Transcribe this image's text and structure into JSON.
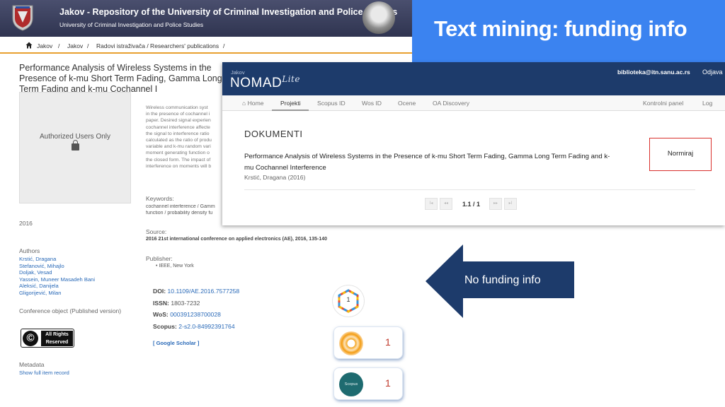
{
  "repository": {
    "title": "Jakov - Repository of the University of Criminal Investigation and Police Studies",
    "subtitle": "University of Criminal Investigation and Police Studies",
    "breadcrumbs": [
      "Jakov",
      "/",
      "Jakov",
      "/",
      "Radovi istraživača / Researchers' publications",
      "/"
    ],
    "doc_title": "Performance Analysis of Wireless Systems in the Presence of k-mu Short Term Fading, Gamma Long Term Fading and k-mu Cochannel I",
    "auth_box": "Authorized Users Only",
    "abstract_lines": [
      "Wireless communication syst",
      "in the presence of cochannel i",
      "paper. Desired signal experien",
      "cochannel interference affecte",
      "the signal to interference ratio",
      "calculated as the ratio of produ",
      "variable and k-mu random vari",
      "moment generating function o",
      "the closed form. The impact of",
      "interference on moments will b"
    ],
    "keywords_label": "Keywords:",
    "keywords_lines": [
      "cochannel interference / Gamm",
      "function / probability density fu"
    ],
    "year": "2016",
    "source_label": "Source:",
    "source_value": "2016 21st international conference on applied electronics (AE), 2016, 135-140",
    "publisher_label": "Publisher:",
    "publisher_value": "• IEEE, New York",
    "authors_label": "Authors",
    "authors": [
      "Krstić, Dragana",
      "Stefanović, Mihajlo",
      "Doljak, Vesad",
      "Yassein, Muneer Masadeh Bani",
      "Aleksić, Danijela",
      "Gligorijević, Milan"
    ],
    "type": "Conference object (Published version)",
    "license": {
      "top": "All Rights",
      "bottom": "Reserved"
    },
    "metadata_label": "Metadata",
    "metadata_link": "Show full item record",
    "ids": {
      "doi_label": "DOI:",
      "doi_value": "10.1109/AE.2016.7577258",
      "issn_label": "ISSN:",
      "issn_value": "1803-7232",
      "wos_label": "WoS:",
      "wos_value": "000391238700028",
      "scopus_label": "Scopus:",
      "scopus_value": "2-s2.0-84992391764"
    },
    "scholar_link": "[ Google Scholar ]",
    "metrics": {
      "dimensions": "1",
      "wos_citations": "1",
      "scopus_citations": "1",
      "scopus_logo_text": "Scopus"
    }
  },
  "slide": {
    "title": "Text mining: funding info",
    "callout": "No funding info",
    "colors": {
      "banner": "#3b83f0",
      "arrow": "#1d3b6b",
      "highlight": "#d9302c"
    }
  },
  "nomad": {
    "jakov_label": "Jakov",
    "brand": "NOMAD",
    "brand_suffix": "Lite",
    "user_email": "biblioteka@itn.sanu.ac.rs",
    "logout": "Odjava",
    "nav": [
      {
        "label": "⌂ Home",
        "icon": "home-icon"
      },
      {
        "label": "Projekti",
        "active": true
      },
      {
        "label": "Scopus ID"
      },
      {
        "label": "Wos ID"
      },
      {
        "label": "Ocene"
      },
      {
        "label": "OA Discovery"
      }
    ],
    "nav_right": [
      "Kontrolni panel",
      "Log"
    ],
    "section_title": "DOKUMENTI",
    "item_title": "Performance Analysis of Wireless Systems in the Presence of k-mu Short Term Fading, Gamma Long Term Fading and k-mu Cochannel Interference",
    "item_meta": "Krstić, Dragana (2016)",
    "action_button": "Normiraj",
    "pagination": {
      "first": "I◂",
      "prev": "◂◂",
      "current": "1.1 / 1",
      "next": "▸▸",
      "last": "▸I"
    }
  }
}
